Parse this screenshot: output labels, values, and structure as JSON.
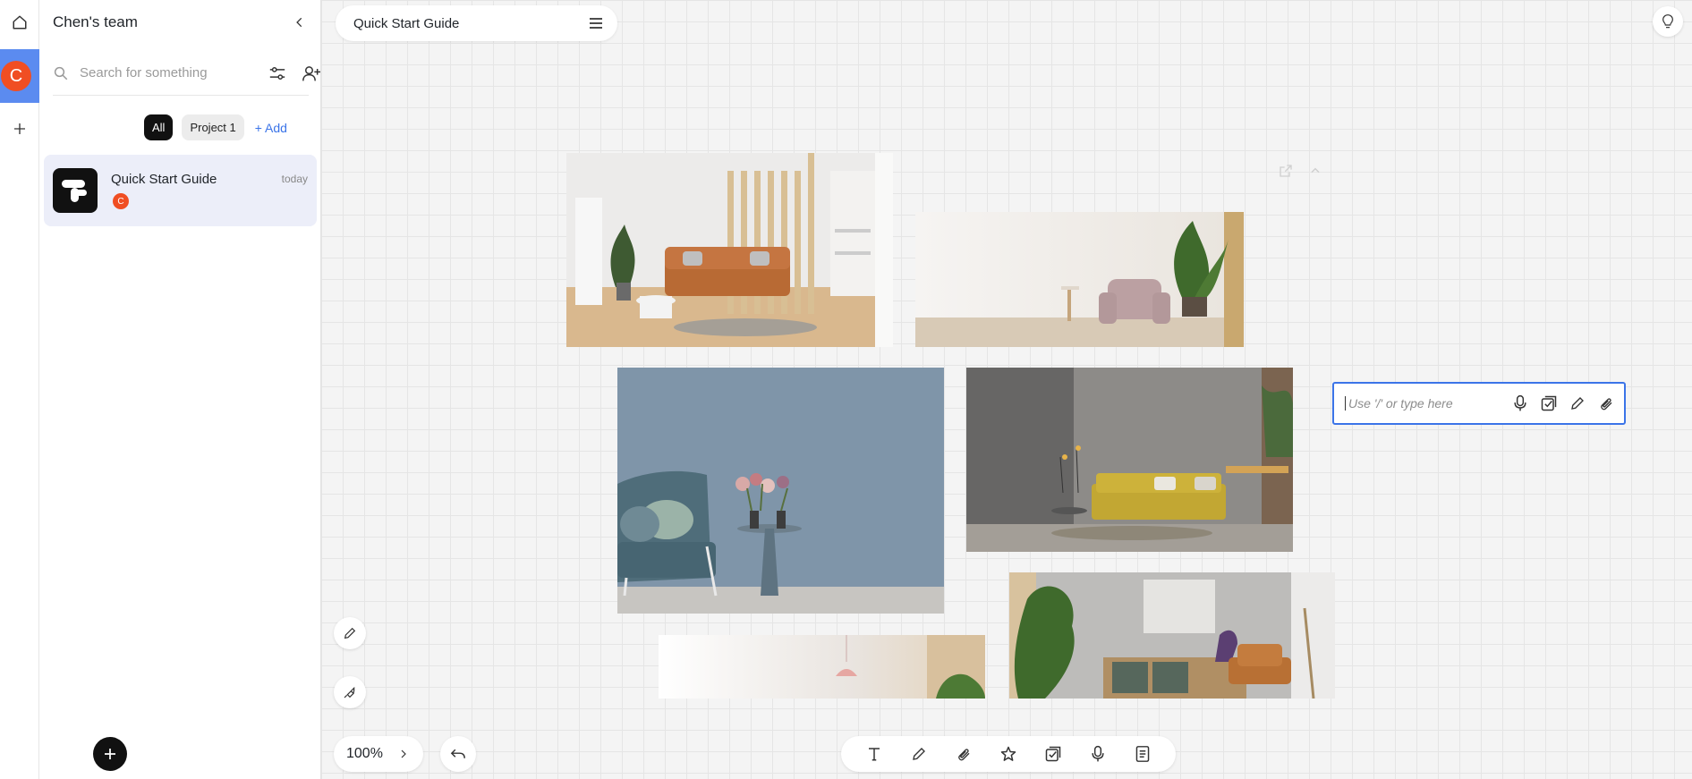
{
  "rail": {
    "home_icon": "home-icon",
    "team_avatar_letter": "C",
    "add_icon": "plus-icon"
  },
  "sidebar": {
    "team_title": "Chen's team",
    "search": {
      "placeholder": "Search for something",
      "value": ""
    },
    "chips": {
      "all": "All",
      "project": "Project 1",
      "add": "+ Add"
    },
    "documents": [
      {
        "title": "Quick Start Guide",
        "date": "today",
        "owner_initial": "C"
      }
    ]
  },
  "canvas": {
    "doc_tab_title": "Quick Start Guide",
    "note_input": {
      "placeholder": "Use '/' or type here",
      "value": ""
    },
    "zoom": "100%"
  },
  "colors": {
    "accent": "#3b74e8",
    "avatar": "#f04e23",
    "selected_team": "#5b8bf0",
    "selected_doc": "#eceef9"
  },
  "toolbar": {
    "items": [
      "text-icon",
      "pen-icon",
      "paperclip-icon",
      "star-icon",
      "checkbox-icon",
      "microphone-icon",
      "list-doc-icon"
    ]
  }
}
